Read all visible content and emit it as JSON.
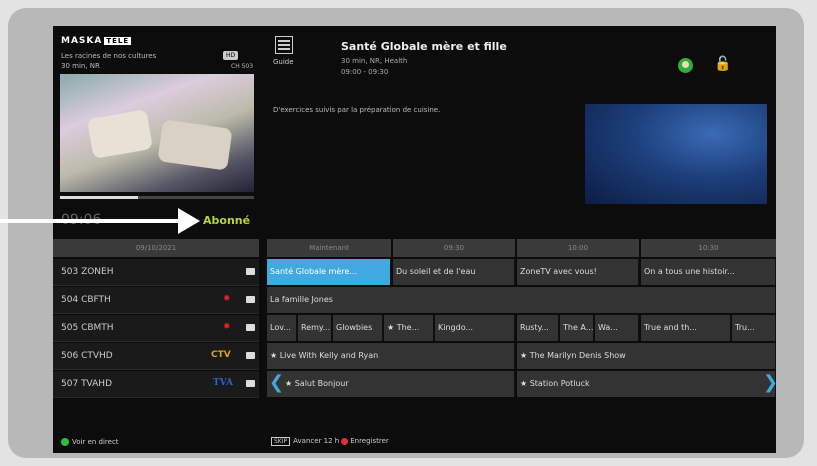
{
  "preview_panel": {
    "logo": "MASKA",
    "logo_badge": "TÉLÉ",
    "title": "Les racines de nos cultures",
    "sub": "30 min, NR",
    "hd_badge": "HD",
    "channel": "CH 503",
    "time": "09:06",
    "status": "Abonné"
  },
  "guide": {
    "label": "Guide",
    "program_title": "Santé Globale mère et fille",
    "program_meta": "30 min, NR, Health",
    "program_time": "09:00 - 09:30",
    "description": "D'exercices suivis par la préparation de cuisine."
  },
  "time_header": {
    "date": "09/10/2021",
    "slots": [
      "Maintenant",
      "09:30",
      "10:00",
      "10:30"
    ]
  },
  "channels": [
    {
      "num": "503",
      "name": "ZONEH",
      "logo": "",
      "logo_color": "#cccccc",
      "cells": [
        {
          "label": "Santé Globale mère...",
          "sel": true
        },
        {
          "label": "Du soleil et de l'eau"
        },
        {
          "label": "ZoneTV avec vous!"
        },
        {
          "label": "On a tous une histoir..."
        }
      ]
    },
    {
      "num": "504",
      "name": "CBFTH",
      "logo": "✸",
      "logo_color": "#e02020",
      "cells": [
        {
          "label": "La famille Jones"
        }
      ]
    },
    {
      "num": "505",
      "name": "CBMTH",
      "logo": "✸",
      "logo_color": "#e02020",
      "cells": [
        {
          "label": "Lov..."
        },
        {
          "label": "Remy..."
        },
        {
          "label": "Glowbies"
        },
        {
          "label": "★ The..."
        },
        {
          "label": "Kingdo..."
        },
        {
          "label": "Rusty..."
        },
        {
          "label": "The A..."
        },
        {
          "label": "Wa..."
        },
        {
          "label": "True and th..."
        },
        {
          "label": "Tru..."
        }
      ]
    },
    {
      "num": "506",
      "name": "CTVHD",
      "logo": "CTV",
      "logo_color": "#e0a020",
      "cells": [
        {
          "label": "★ Live With Kelly and Ryan"
        },
        {
          "label": "★ The Marilyn Denis Show"
        }
      ]
    },
    {
      "num": "507",
      "name": "TVAHD",
      "logo": "TVA",
      "logo_color": "#3060d0",
      "cells": [
        {
          "label": "★ Salut Bonjour"
        },
        {
          "label": "★ Station Potluck"
        }
      ]
    }
  ],
  "footer": {
    "live": "Voir en direct",
    "skip": "SKIP",
    "advance": "Avancer 12 h",
    "record": "Enregistrer"
  },
  "colors": {
    "accent": "#3fa9e0",
    "abonne": "#b6d63a",
    "live": "#2fbf3a",
    "record": "#e03030"
  }
}
